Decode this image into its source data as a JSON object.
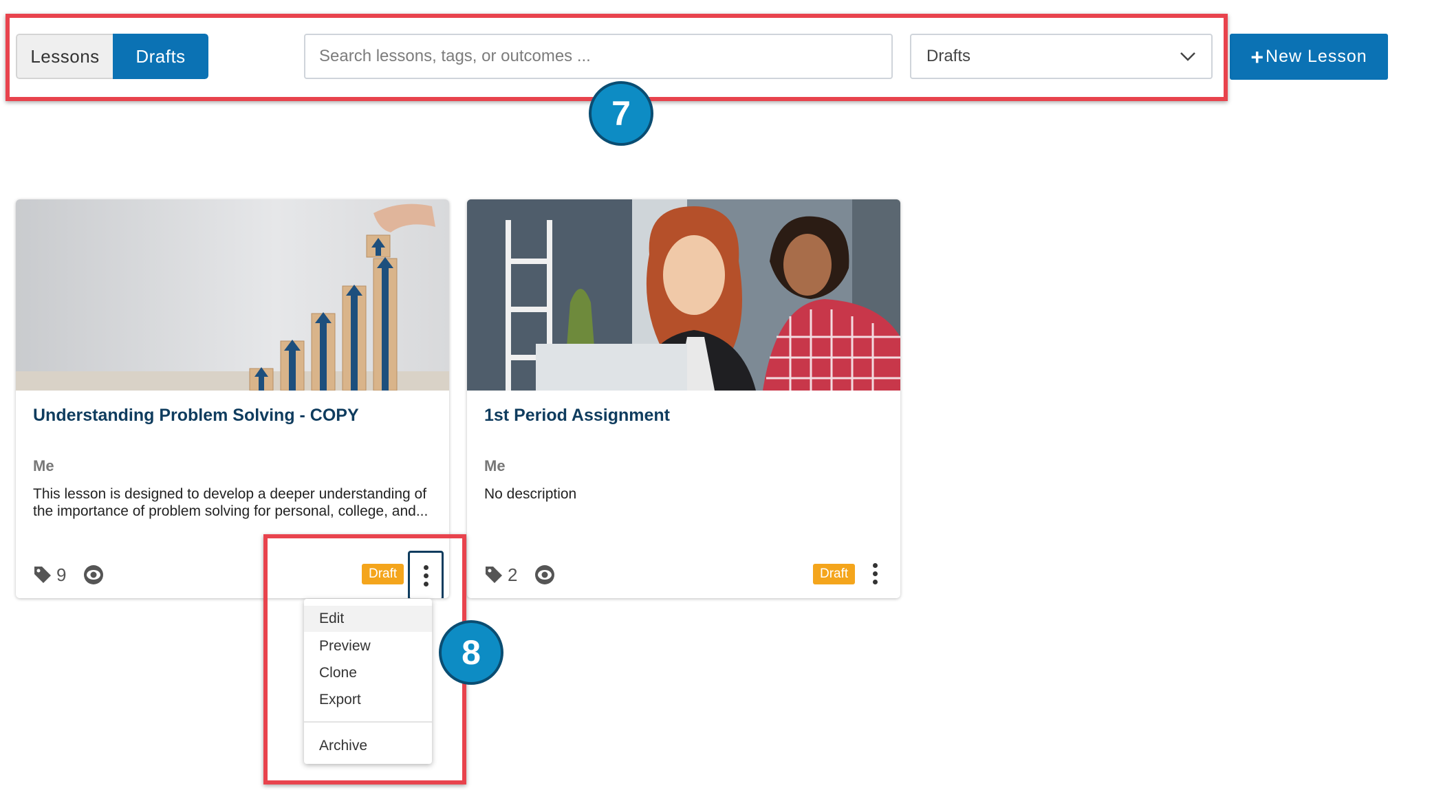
{
  "toolbar": {
    "tabs": [
      {
        "label": "Lessons",
        "active": false
      },
      {
        "label": "Drafts",
        "active": true
      }
    ],
    "search": {
      "placeholder": "Search lessons, tags, or outcomes ..."
    },
    "filter": {
      "selected": "Drafts"
    },
    "new_lesson_label": "New Lesson"
  },
  "callouts": {
    "toolbar_number": "7",
    "menu_number": "8",
    "color": "#e8434d"
  },
  "cards": [
    {
      "title": "Understanding Problem Solving - COPY",
      "author": "Me",
      "description": "This lesson is designed to develop a deeper understanding of the importance of problem solving for personal, college, and...",
      "tag_count": "9",
      "status": "Draft"
    },
    {
      "title": "1st Period Assignment",
      "author": "Me",
      "description": "No description",
      "tag_count": "2",
      "status": "Draft"
    }
  ],
  "menu": {
    "items": [
      "Edit",
      "Preview",
      "Clone",
      "Export"
    ],
    "archive": "Archive"
  },
  "colors": {
    "primary": "#0b72b4",
    "title": "#0f3c5e",
    "draft_badge": "#f4a51c"
  }
}
